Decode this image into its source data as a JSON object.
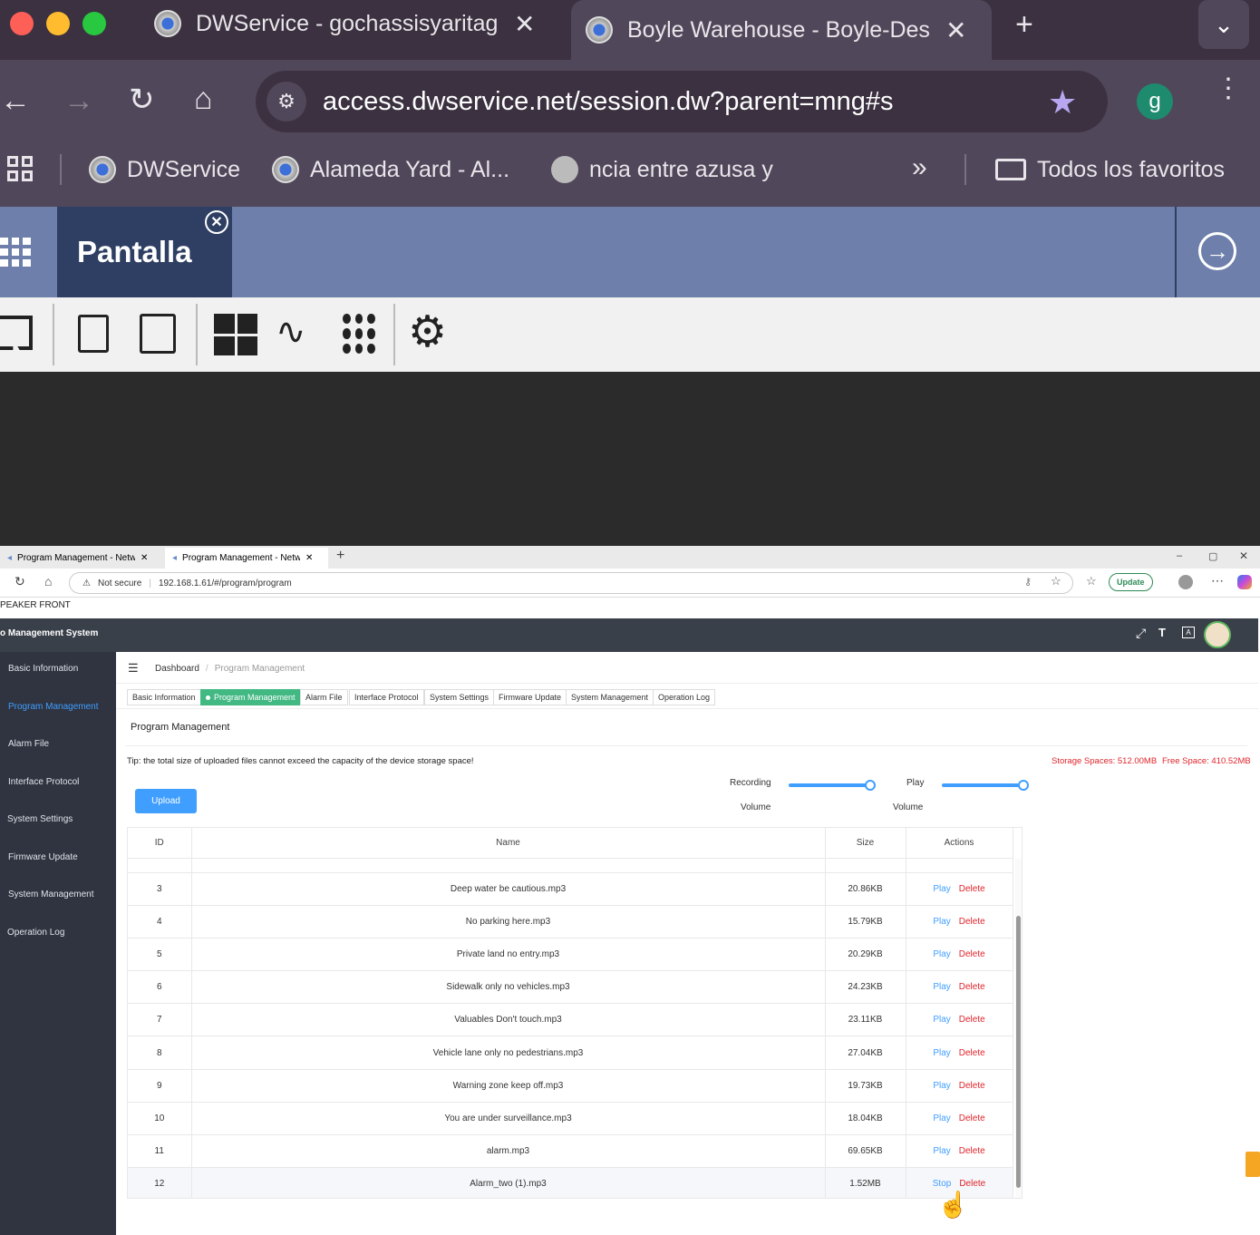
{
  "browser": {
    "tabs": [
      {
        "title": "DWService - gochassisyaritag",
        "icon": "dwservice-gear-icon"
      },
      {
        "title": "Boyle Warehouse - Boyle-Des",
        "icon": "dwservice-gear-icon"
      }
    ],
    "url": "access.dwservice.net/session.dw?parent=mng#s",
    "profile_initial": "g",
    "bookmarks": [
      "DWService",
      "Alameda Yard - Al...",
      "ncia entre azusa y"
    ],
    "all_bookmarks": "Todos los favoritos"
  },
  "dwservice": {
    "tab_title": "Pantalla"
  },
  "remote": {
    "tabs": [
      "Program Management - Network",
      "Program Management - Network"
    ],
    "not_secure": "Not secure",
    "url": "192.168.1.61/#/program/program",
    "update_label": "Update",
    "page_title": "PEAKER FRONT",
    "app_title": "o Management System",
    "sidebar": [
      "Basic Information",
      "Program Management",
      "Alarm File",
      "Interface Protocol",
      "System Settings",
      "Firmware Update",
      "System Management",
      "Operation Log"
    ],
    "breadcrumb": [
      "Dashboard",
      "/",
      "Program Management"
    ],
    "page_tabs": [
      "Basic Information",
      "Program Management",
      "Alarm File",
      "Interface Protocol",
      "System Settings",
      "Firmware Update",
      "System Management",
      "Operation Log"
    ],
    "section_title": "Program Management",
    "tip": "Tip: the total size of uploaded files cannot exceed the capacity of the device storage space!",
    "storage": "Storage Spaces: 512.00MB",
    "free": "Free Space: 410.52MB",
    "upload": "Upload",
    "recording_label_1": "Recording",
    "recording_label_2": "Volume",
    "recording_volume": 1.0,
    "play_label_1": "Play",
    "play_label_2": "Volume",
    "play_volume": 1.0,
    "columns": [
      "ID",
      "Name",
      "Size",
      "Actions"
    ],
    "rows": [
      {
        "id": "3",
        "name": "Deep water be cautious.mp3",
        "size": "20.86KB",
        "action": "Play",
        "del": "Delete"
      },
      {
        "id": "4",
        "name": "No parking here.mp3",
        "size": "15.79KB",
        "action": "Play",
        "del": "Delete"
      },
      {
        "id": "5",
        "name": "Private land no entry.mp3",
        "size": "20.29KB",
        "action": "Play",
        "del": "Delete"
      },
      {
        "id": "6",
        "name": "Sidewalk only no vehicles.mp3",
        "size": "24.23KB",
        "action": "Play",
        "del": "Delete"
      },
      {
        "id": "7",
        "name": "Valuables Don't touch.mp3",
        "size": "23.11KB",
        "action": "Play",
        "del": "Delete"
      },
      {
        "id": "8",
        "name": "Vehicle lane only no pedestrians.mp3",
        "size": "27.04KB",
        "action": "Play",
        "del": "Delete"
      },
      {
        "id": "9",
        "name": "Warning zone keep off.mp3",
        "size": "19.73KB",
        "action": "Play",
        "del": "Delete"
      },
      {
        "id": "10",
        "name": "You are under surveillance.mp3",
        "size": "18.04KB",
        "action": "Play",
        "del": "Delete"
      },
      {
        "id": "11",
        "name": "alarm.mp3",
        "size": "69.65KB",
        "action": "Play",
        "del": "Delete"
      },
      {
        "id": "12",
        "name": "Alarm_two (1).mp3",
        "size": "1.52MB",
        "action": "Stop",
        "del": "Delete"
      }
    ]
  }
}
